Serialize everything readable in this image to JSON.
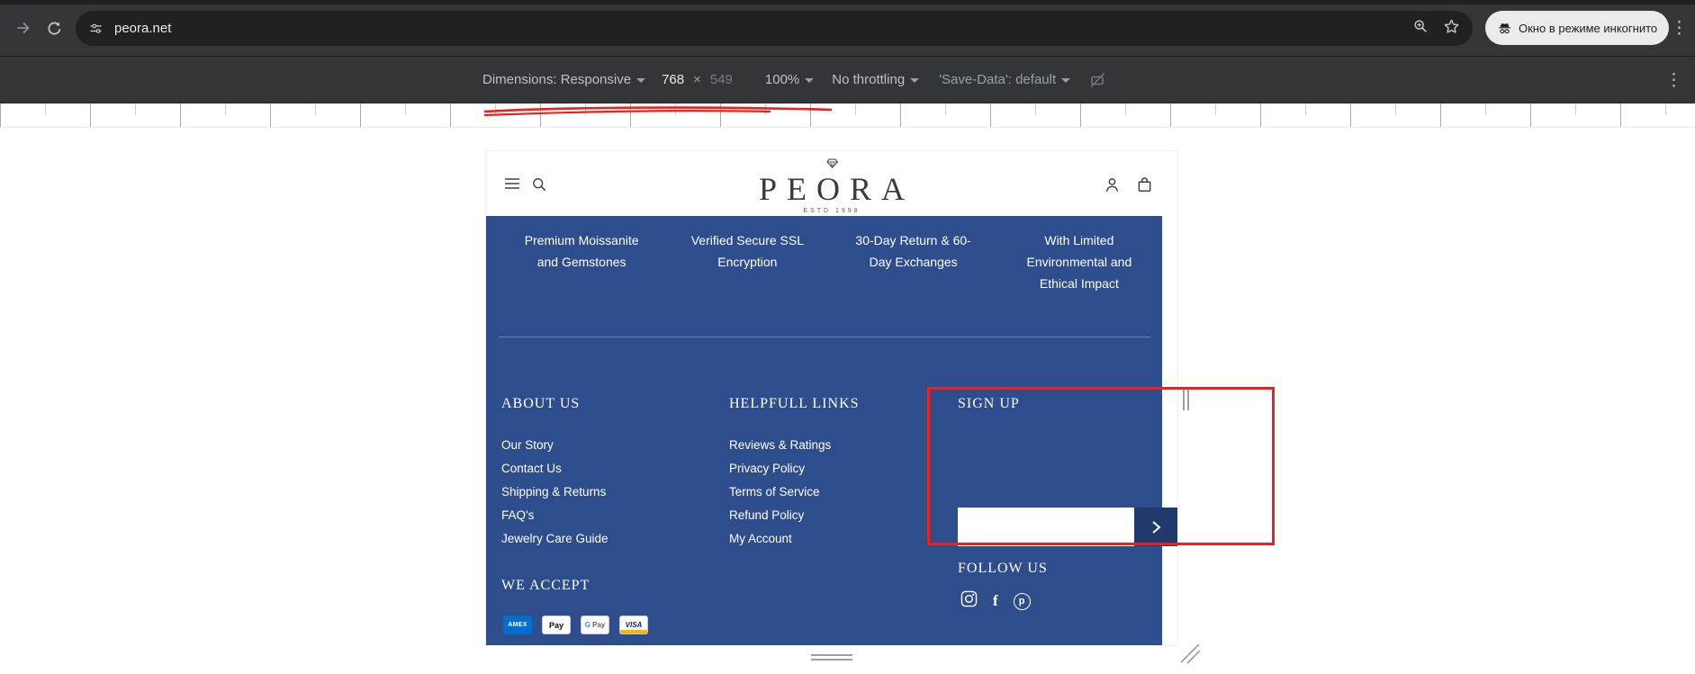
{
  "browser": {
    "url": "peora.net",
    "incognito_label": "Окно в режиме инкогнито",
    "icons": [
      "forward-arrow",
      "reload",
      "site-settings",
      "zoom-in",
      "bookmark-star",
      "incognito",
      "menu-kebab"
    ]
  },
  "devtools": {
    "dimensions_label": "Dimensions: Responsive",
    "width_value": "768",
    "separator": "×",
    "height_value": "549",
    "zoom_value": "100%",
    "throttling_value": "No throttling",
    "save_data_value": "'Save-Data': default",
    "icons": [
      "rotate-disabled",
      "menu-kebab",
      "resize-handle-right",
      "resize-handle-bottom",
      "resize-handle-corner"
    ]
  },
  "annotations": {
    "color": "#e8221c",
    "shapes": [
      "underline-on-dimensions",
      "rect-around-signup"
    ]
  },
  "page": {
    "header": {
      "logo": "PEORA",
      "logo_sub": "ESTD 1998",
      "icons": [
        "menu",
        "search",
        "diamond-ring",
        "account",
        "cart"
      ]
    },
    "benefits": [
      {
        "lines": [
          "Premium Moissanite",
          "and Gemstones",
          ""
        ]
      },
      {
        "lines": [
          "Verified Secure SSL",
          "Encryption",
          ""
        ]
      },
      {
        "lines": [
          "30-Day Return & 60-",
          "Day Exchanges",
          ""
        ]
      },
      {
        "lines": [
          "With Limited",
          "Environmental and",
          "Ethical Impact"
        ]
      }
    ],
    "footer": {
      "about": {
        "title": "ABOUT US",
        "links": [
          "Our Story",
          "Contact Us",
          "Shipping & Returns",
          "FAQ's",
          "Jewelry Care Guide"
        ]
      },
      "helpful": {
        "title": "HELPFULL LINKS",
        "links": [
          "Reviews & Ratings",
          "Privacy Policy",
          "Terms of Service",
          "Refund Policy",
          "My Account"
        ]
      },
      "signup": {
        "title": "SIGN UP",
        "input_value": "",
        "follow_title": "FOLLOW US",
        "social": [
          {
            "name": "instagram",
            "glyph": ""
          },
          {
            "name": "facebook",
            "glyph": "f"
          },
          {
            "name": "pinterest",
            "glyph": "p"
          }
        ]
      },
      "accept": {
        "title": "WE ACCEPT",
        "methods": [
          {
            "name": "amex",
            "label": "AMEX"
          },
          {
            "name": "apple-pay",
            "label": "Pay"
          },
          {
            "name": "google-pay",
            "g": "G",
            "pay": "Pay"
          },
          {
            "name": "visa",
            "label": "VISA"
          }
        ]
      }
    },
    "colors": {
      "navy": "#2e4d8c",
      "signup_button": "#203a6d"
    }
  }
}
